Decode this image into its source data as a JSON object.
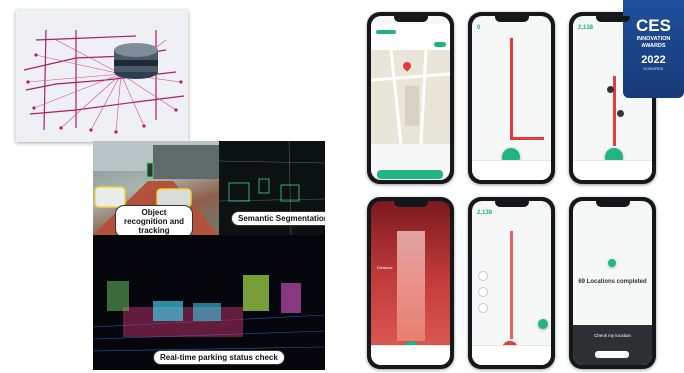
{
  "captions": {
    "object_recognition": "Object recognition and tracking",
    "semantic_segmentation": "Semantic Segmentation",
    "parking_status": "Real-time parking status check"
  },
  "badge": {
    "brand": "CES",
    "line1": "INNOVATION",
    "line2": "AWARDS",
    "year": "2022",
    "tier": "HONOREE"
  },
  "phones": {
    "p2_counter": "0",
    "p3_counter": "2,138",
    "p5_counter": "2,138",
    "p4_distance_label": "Distance",
    "p6_completed": "69 Locations completed",
    "p6_check": "Check my location"
  },
  "colors": {
    "accent_green": "#22b583",
    "route_red": "#e53b3b",
    "badge_blue": "#1e4f9c"
  }
}
